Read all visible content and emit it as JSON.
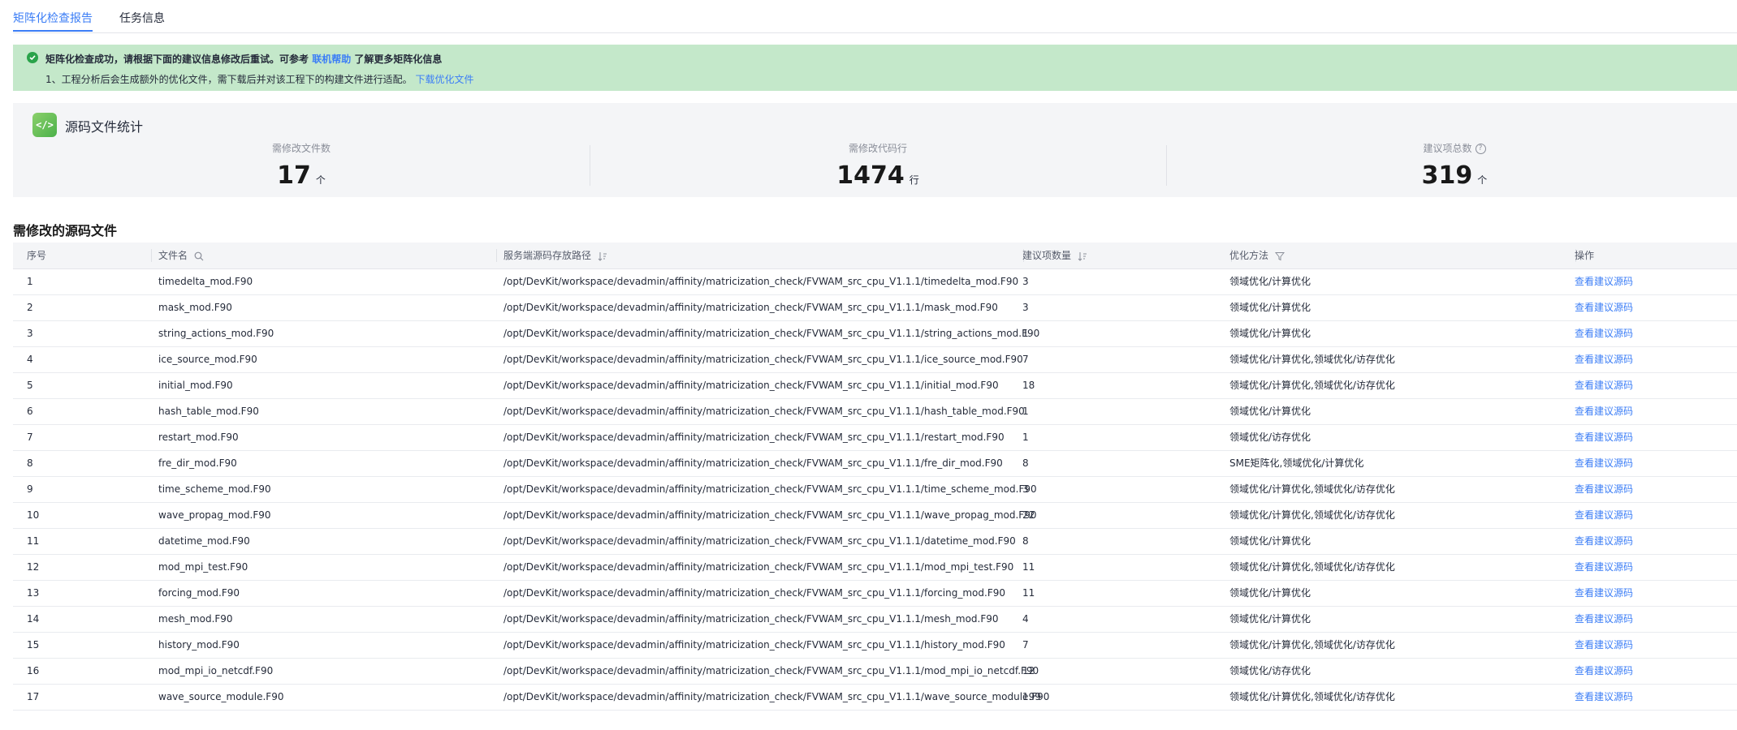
{
  "tabs": [
    {
      "label": "矩阵化检查报告",
      "active": true
    },
    {
      "label": "任务信息",
      "active": false
    }
  ],
  "banner": {
    "title_prefix": "矩阵化检查成功，请根据下面的建议信息修改后重试。可参考",
    "title_link": "联机帮助",
    "title_suffix": "了解更多矩阵化信息",
    "detail_text": "1、工程分析后会生成额外的优化文件，需下载后并对该工程下的构建文件进行适配。",
    "detail_link": "下载优化文件"
  },
  "stats": {
    "title": "源码文件统计",
    "items": [
      {
        "label": "需修改文件数",
        "value": "17",
        "unit": "个"
      },
      {
        "label": "需修改代码行",
        "value": "1474",
        "unit": "行"
      },
      {
        "label": "建议项总数",
        "value": "319",
        "unit": "个",
        "help": "?"
      }
    ]
  },
  "section_title": "需修改的源码文件",
  "table": {
    "columns": [
      "序号",
      "文件名",
      "服务端源码存放路径",
      "建议项数量",
      "优化方法",
      "操作"
    ],
    "action_label": "查看建议源码",
    "rows": [
      {
        "idx": "1",
        "name": "timedelta_mod.F90",
        "path": "/opt/DevKit/workspace/devadmin/affinity/matricization_check/FVWAM_src_cpu_V1.1.1/timedelta_mod.F90",
        "count": "3",
        "method": "领域优化/计算优化"
      },
      {
        "idx": "2",
        "name": "mask_mod.F90",
        "path": "/opt/DevKit/workspace/devadmin/affinity/matricization_check/FVWAM_src_cpu_V1.1.1/mask_mod.F90",
        "count": "3",
        "method": "领域优化/计算优化"
      },
      {
        "idx": "3",
        "name": "string_actions_mod.F90",
        "path": "/opt/DevKit/workspace/devadmin/affinity/matricization_check/FVWAM_src_cpu_V1.1.1/string_actions_mod.F90",
        "count": "1",
        "method": "领域优化/计算优化"
      },
      {
        "idx": "4",
        "name": "ice_source_mod.F90",
        "path": "/opt/DevKit/workspace/devadmin/affinity/matricization_check/FVWAM_src_cpu_V1.1.1/ice_source_mod.F90",
        "count": "7",
        "method": "领域优化/计算优化,领域优化/访存优化"
      },
      {
        "idx": "5",
        "name": "initial_mod.F90",
        "path": "/opt/DevKit/workspace/devadmin/affinity/matricization_check/FVWAM_src_cpu_V1.1.1/initial_mod.F90",
        "count": "18",
        "method": "领域优化/计算优化,领域优化/访存优化"
      },
      {
        "idx": "6",
        "name": "hash_table_mod.F90",
        "path": "/opt/DevKit/workspace/devadmin/affinity/matricization_check/FVWAM_src_cpu_V1.1.1/hash_table_mod.F90",
        "count": "1",
        "method": "领域优化/计算优化"
      },
      {
        "idx": "7",
        "name": "restart_mod.F90",
        "path": "/opt/DevKit/workspace/devadmin/affinity/matricization_check/FVWAM_src_cpu_V1.1.1/restart_mod.F90",
        "count": "1",
        "method": "领域优化/访存优化"
      },
      {
        "idx": "8",
        "name": "fre_dir_mod.F90",
        "path": "/opt/DevKit/workspace/devadmin/affinity/matricization_check/FVWAM_src_cpu_V1.1.1/fre_dir_mod.F90",
        "count": "8",
        "method": "SME矩阵化,领域优化/计算优化"
      },
      {
        "idx": "9",
        "name": "time_scheme_mod.F90",
        "path": "/opt/DevKit/workspace/devadmin/affinity/matricization_check/FVWAM_src_cpu_V1.1.1/time_scheme_mod.F90",
        "count": "3",
        "method": "领域优化/计算优化,领域优化/访存优化"
      },
      {
        "idx": "10",
        "name": "wave_propag_mod.F90",
        "path": "/opt/DevKit/workspace/devadmin/affinity/matricization_check/FVWAM_src_cpu_V1.1.1/wave_propag_mod.F90",
        "count": "22",
        "method": "领域优化/计算优化,领域优化/访存优化"
      },
      {
        "idx": "11",
        "name": "datetime_mod.F90",
        "path": "/opt/DevKit/workspace/devadmin/affinity/matricization_check/FVWAM_src_cpu_V1.1.1/datetime_mod.F90",
        "count": "8",
        "method": "领域优化/计算优化"
      },
      {
        "idx": "12",
        "name": "mod_mpi_test.F90",
        "path": "/opt/DevKit/workspace/devadmin/affinity/matricization_check/FVWAM_src_cpu_V1.1.1/mod_mpi_test.F90",
        "count": "11",
        "method": "领域优化/计算优化,领域优化/访存优化"
      },
      {
        "idx": "13",
        "name": "forcing_mod.F90",
        "path": "/opt/DevKit/workspace/devadmin/affinity/matricization_check/FVWAM_src_cpu_V1.1.1/forcing_mod.F90",
        "count": "11",
        "method": "领域优化/计算优化"
      },
      {
        "idx": "14",
        "name": "mesh_mod.F90",
        "path": "/opt/DevKit/workspace/devadmin/affinity/matricization_check/FVWAM_src_cpu_V1.1.1/mesh_mod.F90",
        "count": "4",
        "method": "领域优化/计算优化"
      },
      {
        "idx": "15",
        "name": "history_mod.F90",
        "path": "/opt/DevKit/workspace/devadmin/affinity/matricization_check/FVWAM_src_cpu_V1.1.1/history_mod.F90",
        "count": "7",
        "method": "领域优化/计算优化,领域优化/访存优化"
      },
      {
        "idx": "16",
        "name": "mod_mpi_io_netcdf.F90",
        "path": "/opt/DevKit/workspace/devadmin/affinity/matricization_check/FVWAM_src_cpu_V1.1.1/mod_mpi_io_netcdf.F90",
        "count": "12",
        "method": "领域优化/访存优化"
      },
      {
        "idx": "17",
        "name": "wave_source_module.F90",
        "path": "/opt/DevKit/workspace/devadmin/affinity/matricization_check/FVWAM_src_cpu_V1.1.1/wave_source_module.F90",
        "count": "199",
        "method": "领域优化/计算优化,领域优化/访存优化"
      }
    ]
  },
  "colors": {
    "accent": "#3c7ef6",
    "success_bg": "#c4e8ca",
    "success_icon": "#2aa34a"
  }
}
